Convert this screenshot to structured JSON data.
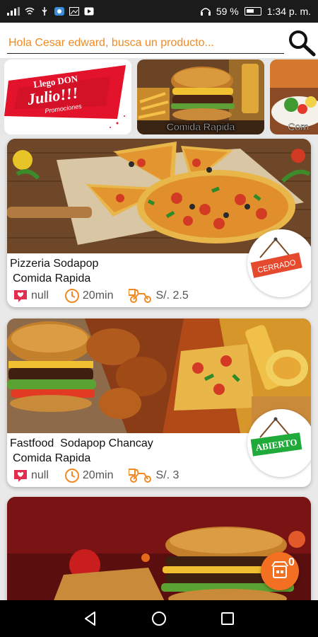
{
  "status_bar": {
    "battery": "59 %",
    "time": "1:34 p. m."
  },
  "search": {
    "placeholder": "Hola Cesar edward, busca un producto..."
  },
  "categories": [
    {
      "name": "promo",
      "banner_line1": "Llego DON",
      "banner_line2": "Julio!!!",
      "banner_line3": "Promociones"
    },
    {
      "name": "Comida Rapida"
    },
    {
      "name": "Com"
    }
  ],
  "restaurants": [
    {
      "name": "Pizzeria Sodapop",
      "type": "Comida Rapida",
      "rating": "null",
      "time": "20min",
      "delivery": "S/. 2.5",
      "status": "CERRADO"
    },
    {
      "name": "Fastfood  Sodapop Chancay",
      "type": "Comida Rapida",
      "rating": "null",
      "time": "20min",
      "delivery": "S/. 3",
      "status": "ABIERTO"
    }
  ],
  "cart": {
    "count": "0"
  },
  "colors": {
    "accent": "#f36f21",
    "closed": "#e64a2e",
    "open": "#1faa3a"
  },
  "icons": [
    "search-icon",
    "heart-icon",
    "clock-icon",
    "delivery-bike-icon",
    "cart-icon",
    "back-icon",
    "home-icon",
    "recents-icon"
  ]
}
